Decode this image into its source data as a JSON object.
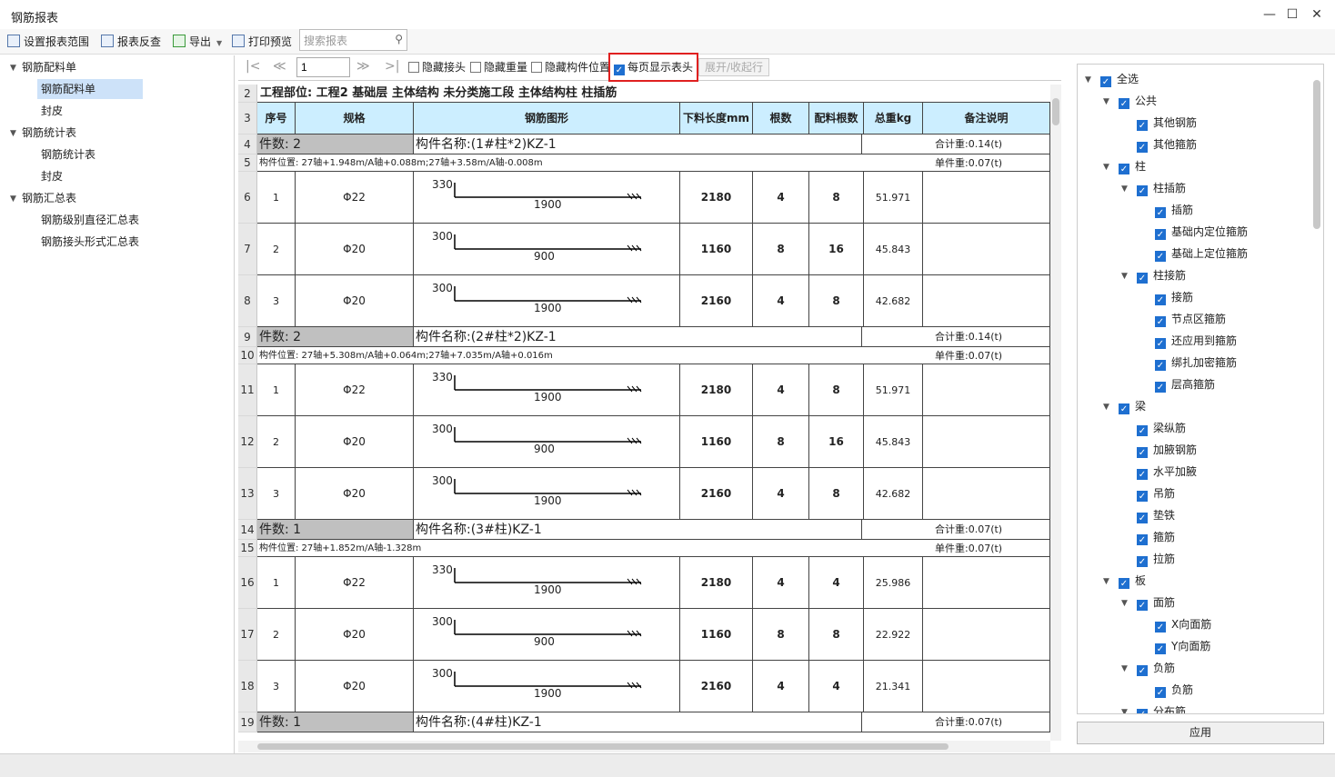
{
  "window": {
    "title": "钢筋报表"
  },
  "toolbar": {
    "set_range": "设置报表范围",
    "reverse": "报表反查",
    "export": "导出",
    "print_preview": "打印预览",
    "search_placeholder": "搜索报表"
  },
  "left_tree": [
    {
      "label": "钢筋配料单",
      "children": [
        {
          "label": "钢筋配料单",
          "selected": true
        },
        {
          "label": "封皮"
        }
      ]
    },
    {
      "label": "钢筋统计表",
      "children": [
        {
          "label": "钢筋统计表"
        },
        {
          "label": "封皮"
        }
      ]
    },
    {
      "label": "钢筋汇总表",
      "children": [
        {
          "label": "钢筋级别直径汇总表"
        },
        {
          "label": "钢筋接头形式汇总表"
        }
      ]
    }
  ],
  "report_toolbar": {
    "page": "1",
    "hide_joint": "隐藏接头",
    "hide_weight": "隐藏重量",
    "hide_position": "隐藏构件位置",
    "show_header": "每页显示表头",
    "expand_collapse": "展开/收起行"
  },
  "report": {
    "title_row": "工程部位: 工程2 基础层 主体结构 未分类施工段 主体结构柱 柱插筋",
    "headers": [
      "序号",
      "规格",
      "钢筋图形",
      "下料长度mm",
      "根数",
      "配料根数",
      "总重kg",
      "备注说明"
    ],
    "groups": [
      {
        "count": "件数: 2",
        "name": "构件名称:(1#柱*2)KZ-1",
        "total": "合计重:0.14(t)",
        "position": "构件位置: 27轴+1.948m/A轴+0.088m;27轴+3.58m/A轴-0.008m",
        "unit": "单件重:0.07(t)",
        "bars": [
          {
            "no": "1",
            "spec": "Φ22",
            "a": "330",
            "b": "1900",
            "len": "2180",
            "n": "4",
            "pn": "8",
            "w": "51.971"
          },
          {
            "no": "2",
            "spec": "Φ20",
            "a": "300",
            "b": "900",
            "len": "1160",
            "n": "8",
            "pn": "16",
            "w": "45.843"
          },
          {
            "no": "3",
            "spec": "Φ20",
            "a": "300",
            "b": "1900",
            "len": "2160",
            "n": "4",
            "pn": "8",
            "w": "42.682"
          }
        ]
      },
      {
        "count": "件数: 2",
        "name": "构件名称:(2#柱*2)KZ-1",
        "total": "合计重:0.14(t)",
        "position": "构件位置: 27轴+5.308m/A轴+0.064m;27轴+7.035m/A轴+0.016m",
        "unit": "单件重:0.07(t)",
        "bars": [
          {
            "no": "1",
            "spec": "Φ22",
            "a": "330",
            "b": "1900",
            "len": "2180",
            "n": "4",
            "pn": "8",
            "w": "51.971"
          },
          {
            "no": "2",
            "spec": "Φ20",
            "a": "300",
            "b": "900",
            "len": "1160",
            "n": "8",
            "pn": "16",
            "w": "45.843"
          },
          {
            "no": "3",
            "spec": "Φ20",
            "a": "300",
            "b": "1900",
            "len": "2160",
            "n": "4",
            "pn": "8",
            "w": "42.682"
          }
        ]
      },
      {
        "count": "件数: 1",
        "name": "构件名称:(3#柱)KZ-1",
        "total": "合计重:0.07(t)",
        "position": "构件位置: 27轴+1.852m/A轴-1.328m",
        "unit": "单件重:0.07(t)",
        "bars": [
          {
            "no": "1",
            "spec": "Φ22",
            "a": "330",
            "b": "1900",
            "len": "2180",
            "n": "4",
            "pn": "4",
            "w": "25.986"
          },
          {
            "no": "2",
            "spec": "Φ20",
            "a": "300",
            "b": "900",
            "len": "1160",
            "n": "8",
            "pn": "8",
            "w": "22.922"
          },
          {
            "no": "3",
            "spec": "Φ20",
            "a": "300",
            "b": "1900",
            "len": "2160",
            "n": "4",
            "pn": "4",
            "w": "21.341"
          }
        ]
      },
      {
        "count": "件数: 1",
        "name": "构件名称:(4#柱)KZ-1",
        "total": "合计重:0.07(t)",
        "position": "",
        "unit": "",
        "bars": []
      }
    ],
    "row_numbers": [
      "2",
      "3",
      "4",
      "5",
      "6",
      "7",
      "8",
      "9",
      "10",
      "11",
      "12",
      "13",
      "14",
      "15",
      "16",
      "17",
      "18",
      "19"
    ]
  },
  "filter_tree": [
    {
      "label": "全选",
      "level": 0,
      "arrow": true
    },
    {
      "label": "公共",
      "level": 1,
      "arrow": true
    },
    {
      "label": "其他钢筋",
      "level": 2
    },
    {
      "label": "其他箍筋",
      "level": 2
    },
    {
      "label": "柱",
      "level": 1,
      "arrow": true
    },
    {
      "label": "柱插筋",
      "level": 2,
      "arrow": true
    },
    {
      "label": "插筋",
      "level": 3
    },
    {
      "label": "基础内定位箍筋",
      "level": 3
    },
    {
      "label": "基础上定位箍筋",
      "level": 3
    },
    {
      "label": "柱接筋",
      "level": 2,
      "arrow": true
    },
    {
      "label": "接筋",
      "level": 3
    },
    {
      "label": "节点区箍筋",
      "level": 3
    },
    {
      "label": "还应用到箍筋",
      "level": 3
    },
    {
      "label": "绑扎加密箍筋",
      "level": 3
    },
    {
      "label": "层高箍筋",
      "level": 3
    },
    {
      "label": "梁",
      "level": 1,
      "arrow": true
    },
    {
      "label": "梁纵筋",
      "level": 2
    },
    {
      "label": "加腋钢筋",
      "level": 2
    },
    {
      "label": "水平加腋",
      "level": 2
    },
    {
      "label": "吊筋",
      "level": 2
    },
    {
      "label": "垫铁",
      "level": 2
    },
    {
      "label": "箍筋",
      "level": 2
    },
    {
      "label": "拉筋",
      "level": 2
    },
    {
      "label": "板",
      "level": 1,
      "arrow": true
    },
    {
      "label": "面筋",
      "level": 2,
      "arrow": true
    },
    {
      "label": "X向面筋",
      "level": 3
    },
    {
      "label": "Y向面筋",
      "level": 3
    },
    {
      "label": "负筋",
      "level": 2,
      "arrow": true
    },
    {
      "label": "负筋",
      "level": 3
    },
    {
      "label": "分布筋",
      "level": 2,
      "arrow": true
    }
  ],
  "apply_label": "应用"
}
